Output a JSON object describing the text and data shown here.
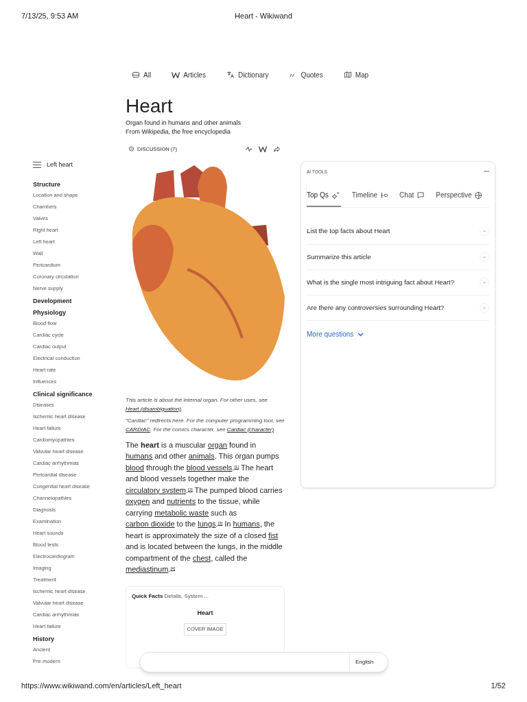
{
  "print_header": {
    "date": "7/13/25, 9:53 AM",
    "title": "Heart - Wikiwand"
  },
  "nav": [
    {
      "label": "All"
    },
    {
      "label": "Articles"
    },
    {
      "label": "Dictionary"
    },
    {
      "label": "Quotes"
    },
    {
      "label": "Map"
    }
  ],
  "article": {
    "title": "Heart",
    "subtitle": "Organ found in humans and other animals",
    "source": "From Wikipedia, the free encyclopedia",
    "discussion": "DISCUSSION (7)",
    "hatnotes": [
      [
        {
          "kind": "text",
          "text": "This article is about the internal organ. For other uses, see "
        },
        {
          "kind": "link",
          "text": "Heart (disambiguation)"
        },
        {
          "kind": "text",
          "text": "."
        }
      ],
      [
        {
          "kind": "text",
          "text": "\"Cardiac\" redirects here. For the computer programming tool, see "
        },
        {
          "kind": "link",
          "text": "CARDIAC"
        },
        {
          "kind": "text",
          "text": ". For the comics character, see "
        },
        {
          "kind": "link",
          "text": "Cardiac (character)"
        },
        {
          "kind": "text",
          "text": "."
        }
      ]
    ],
    "paragraph": [
      {
        "kind": "text",
        "text": "The "
      },
      {
        "kind": "bold",
        "text": "heart"
      },
      {
        "kind": "text",
        "text": " is a muscular "
      },
      {
        "kind": "link",
        "text": "organ"
      },
      {
        "kind": "text",
        "text": " found in "
      },
      {
        "kind": "link",
        "text": "humans"
      },
      {
        "kind": "text",
        "text": " and other "
      },
      {
        "kind": "link",
        "text": "animals"
      },
      {
        "kind": "text",
        "text": ". This organ pumps "
      },
      {
        "kind": "link",
        "text": "blood"
      },
      {
        "kind": "text",
        "text": " through the "
      },
      {
        "kind": "link",
        "text": "blood vessels"
      },
      {
        "kind": "text",
        "text": "."
      },
      {
        "kind": "ref",
        "text": "[1]"
      },
      {
        "kind": "text",
        "text": " The heart and blood vessels together make the "
      },
      {
        "kind": "link",
        "text": "circulatory system"
      },
      {
        "kind": "text",
        "text": "."
      },
      {
        "kind": "ref",
        "text": "[2]"
      },
      {
        "kind": "text",
        "text": " The pumped blood carries "
      },
      {
        "kind": "link",
        "text": "oxygen"
      },
      {
        "kind": "text",
        "text": " and "
      },
      {
        "kind": "link",
        "text": "nutrients"
      },
      {
        "kind": "text",
        "text": " to the tissue, while carrying "
      },
      {
        "kind": "link",
        "text": "metabolic waste"
      },
      {
        "kind": "text",
        "text": " such as "
      },
      {
        "kind": "link",
        "text": "carbon dioxide"
      },
      {
        "kind": "text",
        "text": " to the "
      },
      {
        "kind": "link",
        "text": "lungs"
      },
      {
        "kind": "text",
        "text": "."
      },
      {
        "kind": "ref",
        "text": "[3]"
      },
      {
        "kind": "text",
        "text": " In "
      },
      {
        "kind": "link",
        "text": "humans"
      },
      {
        "kind": "text",
        "text": ", the heart is approximately the size of a closed "
      },
      {
        "kind": "link",
        "text": "fist"
      },
      {
        "kind": "text",
        "text": " and is located between the lungs, in the middle compartment of the "
      },
      {
        "kind": "link",
        "text": "chest"
      },
      {
        "kind": "text",
        "text": ", called the "
      },
      {
        "kind": "link",
        "text": "mediastinum"
      },
      {
        "kind": "text",
        "text": "."
      },
      {
        "kind": "ref",
        "text": "[4]"
      }
    ],
    "quick_facts": {
      "label": "Quick Facts",
      "summary": "Details, System ...",
      "title": "Heart",
      "cover_button": "COVER IMAGE"
    }
  },
  "sidebar": {
    "current": "Left heart",
    "sections": [
      {
        "title": "Structure",
        "children": [
          "Location and shape",
          "Chambers",
          "Valves",
          "Right heart",
          "Left heart",
          "Wall",
          "Pericardium",
          "Coronary circulation",
          "Nerve supply"
        ]
      },
      {
        "title": "Development"
      },
      {
        "title": "Physiology",
        "children": [
          "Blood flow",
          "Cardiac cycle",
          "Cardiac output",
          "Electrical conduction",
          "Heart rate",
          "Influences"
        ]
      },
      {
        "title": "Clinical significance",
        "children": [
          "Diseases",
          "Ischemic heart disease",
          "Heart failure",
          "Cardiomyopathies",
          "Valvular heart disease",
          "Cardiac arrhythmias",
          "Pericardial disease",
          "Congenital heart disease",
          "Channelopathies",
          "Diagnosis",
          "Examination",
          "Heart sounds",
          "Blood tests",
          "Electrocardiogram",
          "Imaging",
          "Treatment",
          "Ischemic heart disease",
          "Valvular heart disease",
          "Cardiac arrhythmias",
          "Heart failure"
        ]
      },
      {
        "title": "History",
        "children": [
          "Ancient",
          "Pre-modern"
        ]
      }
    ]
  },
  "ai_tools": {
    "title": "AI TOOLS",
    "tabs": [
      {
        "label": "Top Qs",
        "selected": true
      },
      {
        "label": "Timeline",
        "selected": false
      },
      {
        "label": "Chat",
        "selected": false
      },
      {
        "label": "Perspective",
        "selected": false
      }
    ],
    "questions": [
      "List the top facts about Heart",
      "Summarize this article",
      "What is the single most intriguing fact about Heart?",
      "Are there any controversies surrounding Heart?"
    ],
    "more": "More questions"
  },
  "language_bar": {
    "language": "English"
  },
  "print_footer": {
    "url": "https://www.wikiwand.com/en/articles/Left_heart",
    "page": "1/52"
  }
}
